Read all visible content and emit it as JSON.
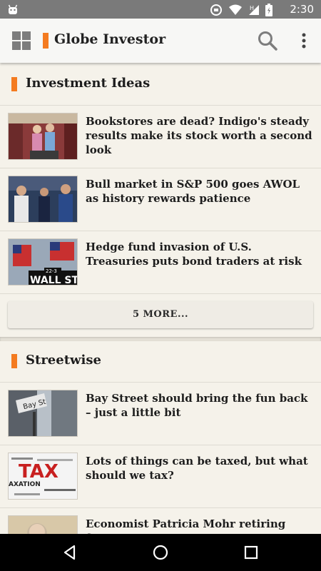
{
  "status_bar": {
    "time": "2:30",
    "icons": [
      "android-icon",
      "sync-icon",
      "wifi-icon",
      "signal-icon",
      "battery-icon"
    ]
  },
  "app_bar": {
    "title": "Globe Investor",
    "accent_color": "#f47b20",
    "icons": [
      "grid-icon",
      "search-icon",
      "more-vert-icon"
    ]
  },
  "sections": [
    {
      "label": "Investment Ideas",
      "articles": [
        {
          "headline": "Bookstores are dead? Indigo's steady results make its stock worth a second look",
          "thumb": "bookstore-photo"
        },
        {
          "headline": "Bull market in S&P 500 goes AWOL as history rewards patience",
          "thumb": "traders-photo"
        },
        {
          "headline": "Hedge fund invasion of U.S. Treasuries puts bond traders at risk",
          "thumb": "wall-street-photo",
          "thumb_text": "WALL ST",
          "thumb_small": "22-3"
        }
      ],
      "more_label": "5 MORE..."
    },
    {
      "label": "Streetwise",
      "articles": [
        {
          "headline": "Bay Street should bring the fun back – just a little bit",
          "thumb": "bay-street-photo",
          "thumb_text": "Bay St"
        },
        {
          "headline": "Lots of things can be taxed, but what should we tax?",
          "thumb": "tax-word-cloud",
          "thumb_text": "TAX",
          "thumb_small": "AXATION"
        },
        {
          "headline": "Economist Patricia Mohr retiring from",
          "thumb": "person-photo"
        }
      ]
    }
  ]
}
